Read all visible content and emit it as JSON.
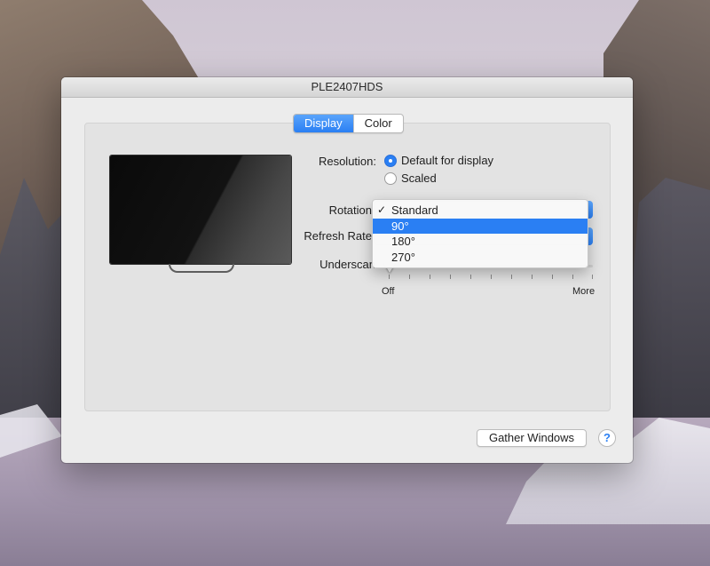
{
  "window": {
    "title": "PLE2407HDS"
  },
  "tabs": [
    {
      "label": "Display",
      "active": true
    },
    {
      "label": "Color",
      "active": false
    }
  ],
  "resolution": {
    "label": "Resolution:",
    "options": [
      {
        "label": "Default for display",
        "selected": true
      },
      {
        "label": "Scaled",
        "selected": false
      }
    ]
  },
  "rotation": {
    "label": "Rotation",
    "menu": [
      {
        "label": "Standard",
        "checked": true,
        "highlighted": false
      },
      {
        "label": "90°",
        "checked": false,
        "highlighted": true
      },
      {
        "label": "180°",
        "checked": false,
        "highlighted": false
      },
      {
        "label": "270°",
        "checked": false,
        "highlighted": false
      }
    ],
    "check_glyph": "✓"
  },
  "refresh_rate": {
    "label": "Refresh Rate"
  },
  "underscan": {
    "label": "Underscan",
    "min_label": "Off",
    "max_label": "More",
    "value_fraction": 0
  },
  "buttons": {
    "gather_windows": "Gather Windows",
    "help": "?"
  },
  "colors": {
    "accent": "#2a7ff3",
    "window_bg": "#ececec",
    "panel_bg": "#e3e3e3"
  }
}
